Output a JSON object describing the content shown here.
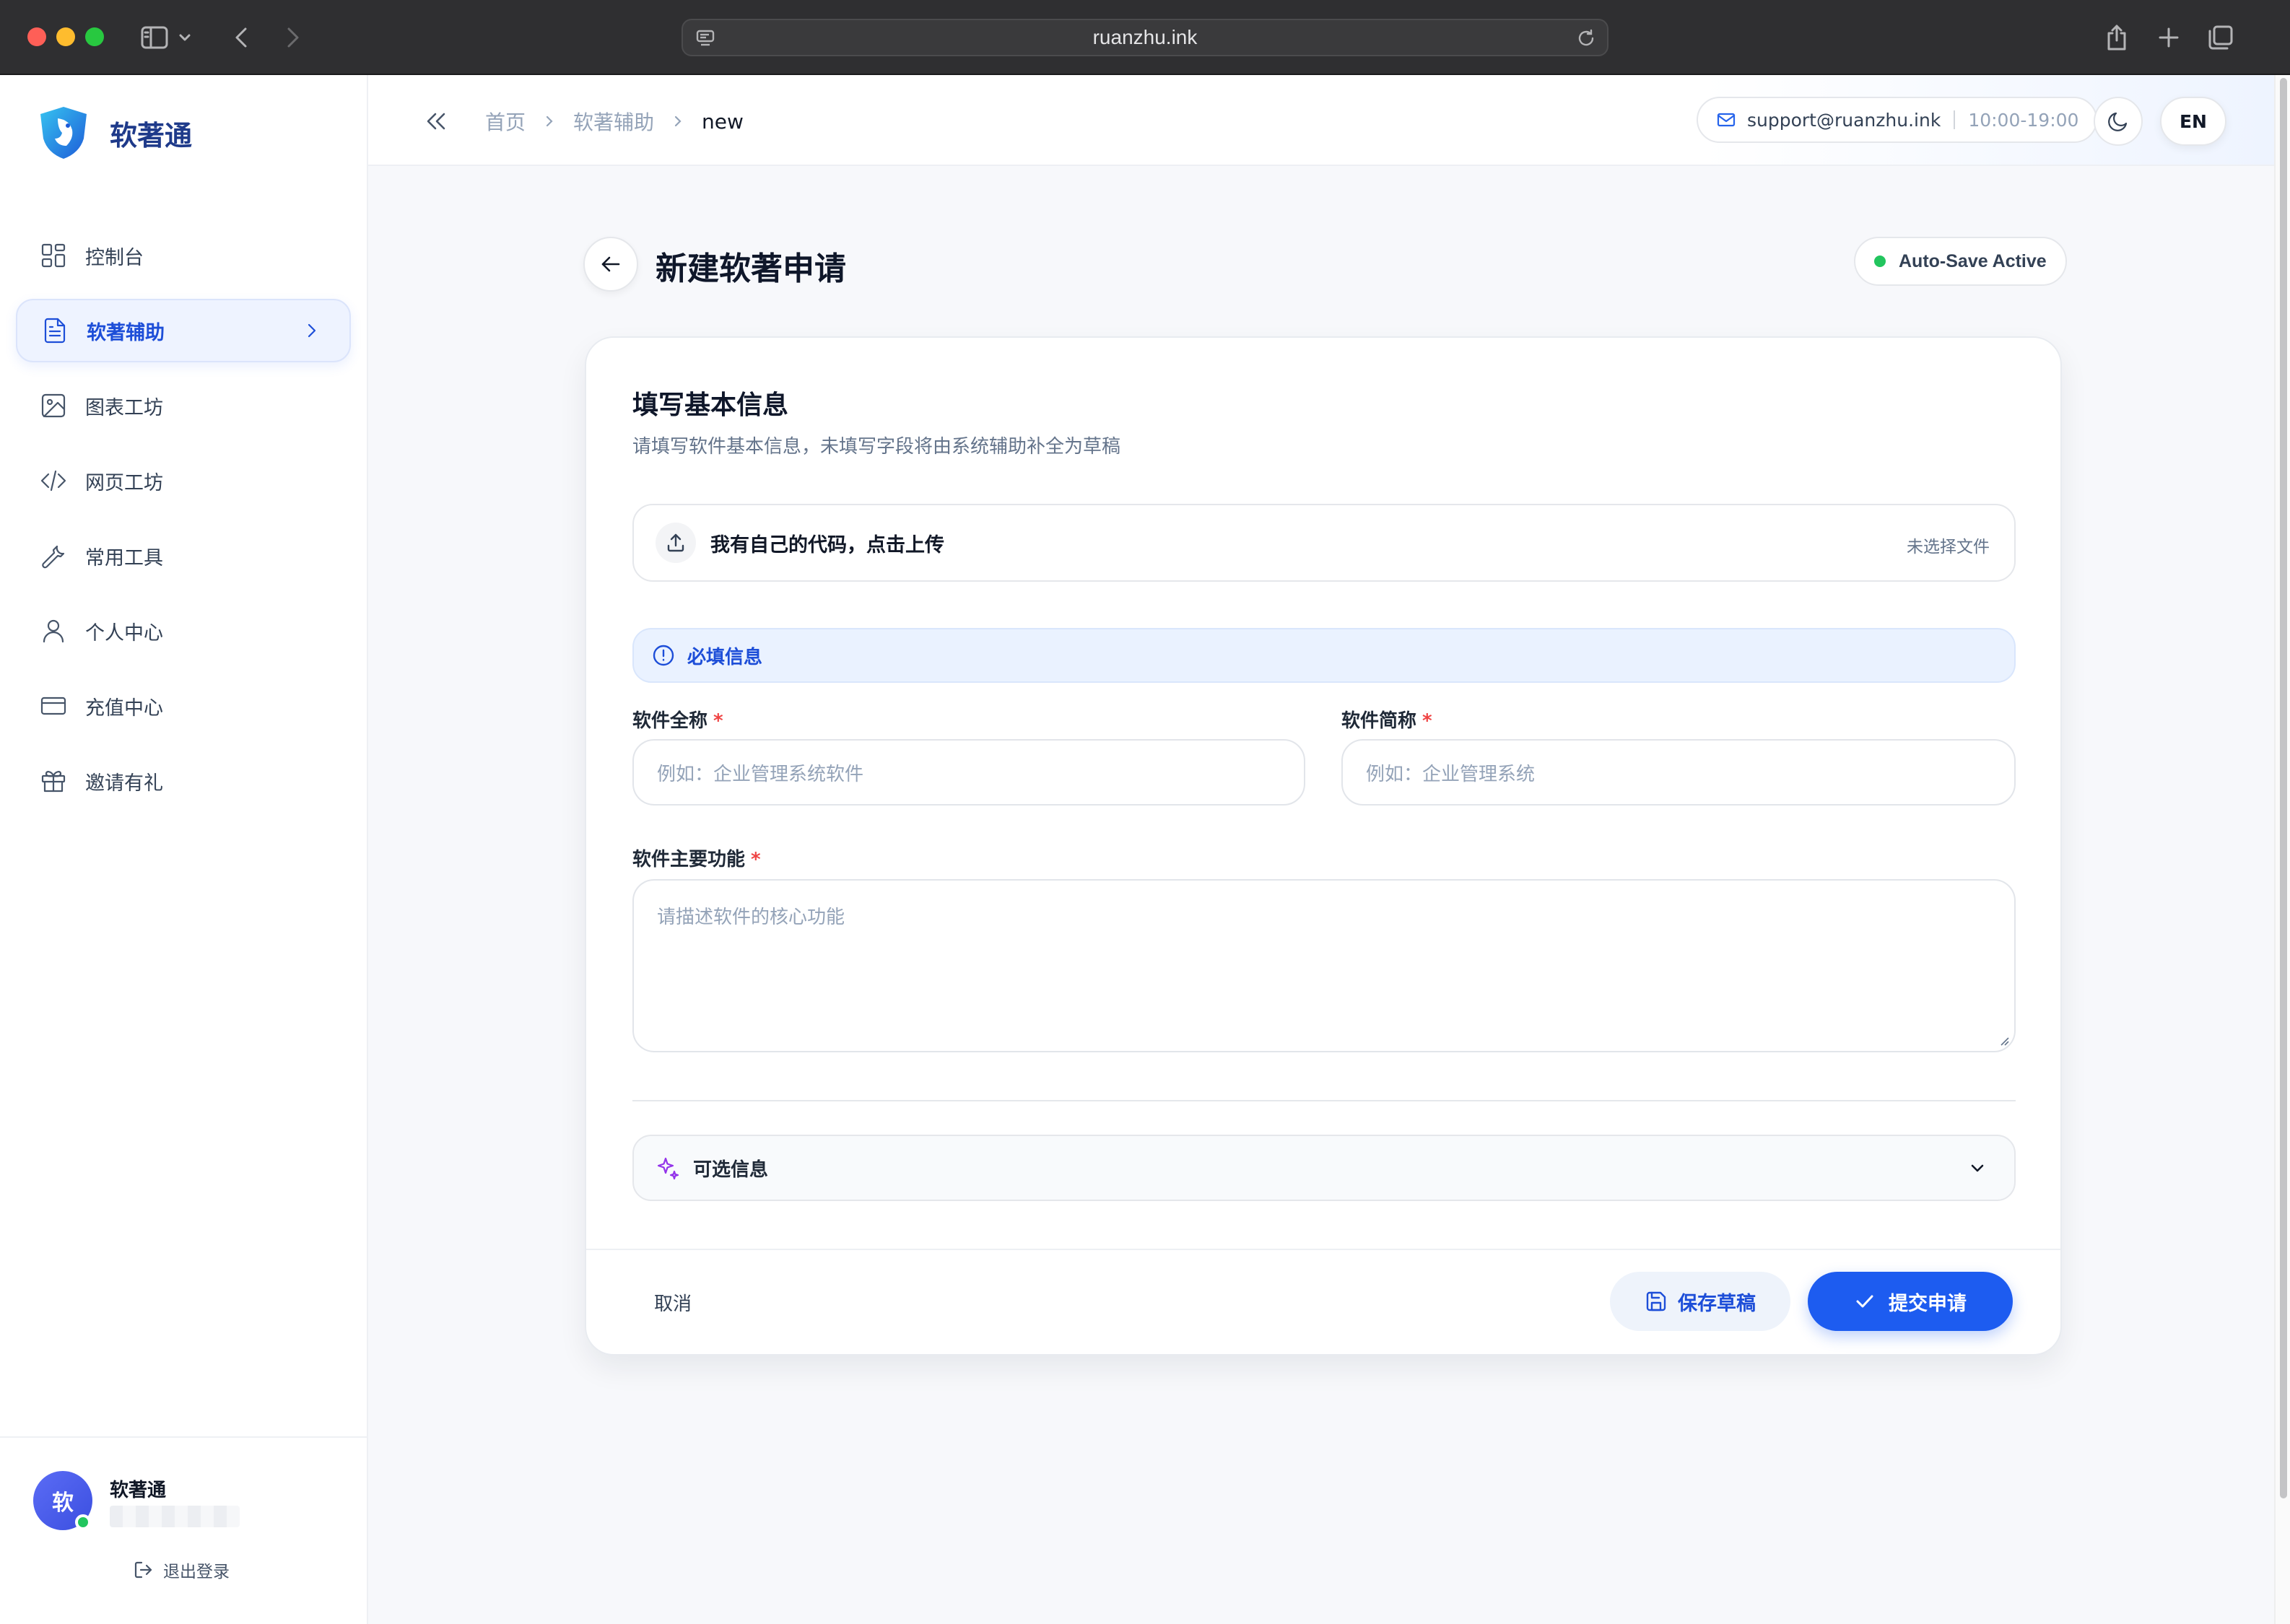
{
  "browser": {
    "url": "ruanzhu.ink"
  },
  "sidebar": {
    "brand": "软著通",
    "items": [
      {
        "label": "控制台",
        "icon": "dashboard-icon"
      },
      {
        "label": "软著辅助",
        "icon": "document-icon",
        "active": true
      },
      {
        "label": "图表工坊",
        "icon": "image-icon"
      },
      {
        "label": "网页工坊",
        "icon": "code-icon"
      },
      {
        "label": "常用工具",
        "icon": "wrench-icon"
      },
      {
        "label": "个人中心",
        "icon": "user-icon"
      },
      {
        "label": "充值中心",
        "icon": "credit-card-icon"
      },
      {
        "label": "邀请有礼",
        "icon": "gift-icon"
      }
    ],
    "user": {
      "avatar_initial": "软",
      "name": "软著通",
      "online": true
    },
    "logout_label": "退出登录"
  },
  "topbar": {
    "breadcrumb": [
      "首页",
      "软著辅助",
      "new"
    ],
    "support_email": "support@ruanzhu.ink",
    "support_hours": "10:00-19:00",
    "language_label": "EN"
  },
  "page": {
    "title": "新建软著申请",
    "autosave_label": "Auto-Save Active",
    "card": {
      "title": "填写基本信息",
      "description": "请填写软件基本信息，未填写字段将由系统辅助补全为草稿",
      "upload": {
        "label": "我有自己的代码，点击上传",
        "status": "未选择文件"
      },
      "required_section_label": "必填信息",
      "fields": {
        "full_name": {
          "label": "软件全称",
          "required_mark": "*",
          "placeholder": "例如：企业管理系统软件",
          "value": ""
        },
        "short_name": {
          "label": "软件简称",
          "required_mark": "*",
          "placeholder": "例如：企业管理系统",
          "value": ""
        },
        "main_function": {
          "label": "软件主要功能",
          "required_mark": "*",
          "placeholder": "请描述软件的核心功能",
          "value": ""
        }
      },
      "optional_section_label": "可选信息"
    },
    "actions": {
      "cancel": "取消",
      "save_draft": "保存草稿",
      "submit": "提交申请"
    }
  },
  "colors": {
    "accent": "#1d5cf0",
    "active_nav_bg": "#eef3ff",
    "online": "#22c55e",
    "required": "#ef4444"
  }
}
